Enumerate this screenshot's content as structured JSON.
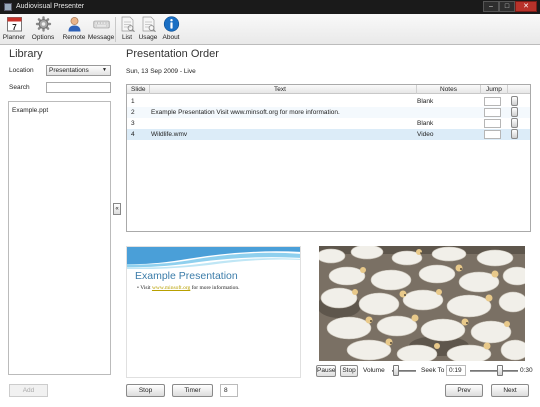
{
  "window": {
    "title": "Audiovisual Presenter",
    "minimize": "–",
    "maximize": "□",
    "close": "✕"
  },
  "toolbar": [
    {
      "label": "Planner",
      "icon": "calendar-icon"
    },
    {
      "label": "Options",
      "icon": "gear-icon"
    },
    {
      "label": "Remote",
      "icon": "person-icon"
    },
    {
      "label": "Message",
      "icon": "keyboard-icon"
    },
    {
      "label": "List",
      "icon": "list-document-icon"
    },
    {
      "label": "Usage",
      "icon": "usage-document-icon"
    },
    {
      "label": "About",
      "icon": "info-icon"
    }
  ],
  "calendar_day": "7",
  "library": {
    "title": "Library",
    "location_label": "Location",
    "location_value": "Presentations",
    "search_label": "Search",
    "search_value": "",
    "items": [
      "Example.ppt"
    ],
    "add_label": "Add"
  },
  "collapse_glyph": "«",
  "presentation": {
    "title": "Presentation Order",
    "date": "Sun, 13 Sep 2009 - Live",
    "columns": {
      "slide": "Slide",
      "text": "Text",
      "notes": "Notes",
      "jump": "Jump"
    },
    "rows": [
      {
        "slide": "1",
        "text": "",
        "notes": "Blank"
      },
      {
        "slide": "2",
        "text": "Example Presentation Visit www.minsoft.org for more information.",
        "notes": ""
      },
      {
        "slide": "3",
        "text": "",
        "notes": "Blank"
      },
      {
        "slide": "4",
        "text": "Wildlife.wmv",
        "notes": "Video"
      }
    ]
  },
  "slide_preview": {
    "title": "Example Presentation",
    "bullet_prefix": "• Visit ",
    "bullet_link": "www.minsoft.org",
    "bullet_suffix": " for more information."
  },
  "video_controls": {
    "pause": "Pause",
    "stop": "Stop",
    "volume_label": "Volume",
    "volume_level": 0.15,
    "seek_label": "Seek To",
    "seek_time": "0:19",
    "seek_level": 0.63,
    "duration": "0:30"
  },
  "bottom": {
    "stop": "Stop",
    "timer": "Timer",
    "timer_value": "8",
    "prev": "Prev",
    "next": "Next"
  },
  "colors": {
    "selected_row": "#dcecf8",
    "slide_title": "#3b7ca9",
    "link": "#b8a000",
    "about_icon": "#1a6fc4"
  }
}
